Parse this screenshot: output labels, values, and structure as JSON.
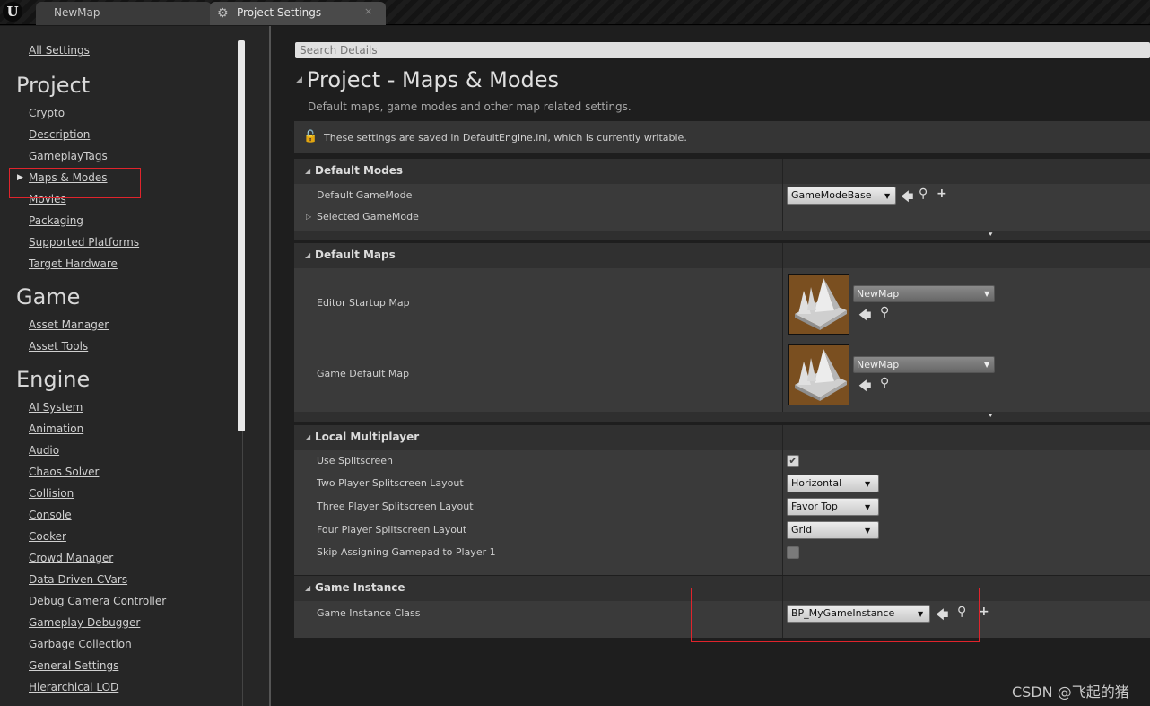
{
  "tabs": [
    {
      "label": "NewMap"
    },
    {
      "label": "Project Settings",
      "close": "×"
    }
  ],
  "logo_text": "U",
  "sidebar": {
    "all_settings": "All Settings",
    "groups": [
      {
        "heading": "Project",
        "items": [
          "Crypto",
          "Description",
          "GameplayTags",
          "Maps & Modes",
          "Movies",
          "Packaging",
          "Supported Platforms",
          "Target Hardware"
        ]
      },
      {
        "heading": "Game",
        "items": [
          "Asset Manager",
          "Asset Tools"
        ]
      },
      {
        "heading": "Engine",
        "items": [
          "AI System",
          "Animation",
          "Audio",
          "Chaos Solver",
          "Collision",
          "Console",
          "Cooker",
          "Crowd Manager",
          "Data Driven CVars",
          "Debug Camera Controller",
          "Gameplay Debugger",
          "Garbage Collection",
          "General Settings",
          "Hierarchical LOD"
        ]
      }
    ],
    "selected": "Maps & Modes"
  },
  "search": {
    "placeholder": "Search Details"
  },
  "page": {
    "title": "Project - Maps & Modes",
    "subtitle": "Default maps, game modes and other map related settings.",
    "notice": "These settings are saved in DefaultEngine.ini, which is currently writable."
  },
  "sections": {
    "default_modes": {
      "title": "Default Modes",
      "default_gamemode_label": "Default GameMode",
      "default_gamemode_value": "GameModeBase",
      "selected_gamemode_label": "Selected GameMode"
    },
    "default_maps": {
      "title": "Default Maps",
      "editor_startup_label": "Editor Startup Map",
      "editor_startup_value": "NewMap",
      "game_default_label": "Game Default Map",
      "game_default_value": "NewMap"
    },
    "local_multiplayer": {
      "title": "Local Multiplayer",
      "use_splitscreen_label": "Use Splitscreen",
      "use_splitscreen_checked": true,
      "two_player_label": "Two Player Splitscreen Layout",
      "two_player_value": "Horizontal",
      "three_player_label": "Three Player Splitscreen Layout",
      "three_player_value": "Favor Top",
      "four_player_label": "Four Player Splitscreen Layout",
      "four_player_value": "Grid",
      "skip_gamepad_label": "Skip Assigning Gamepad to Player 1",
      "skip_gamepad_checked": false
    },
    "game_instance": {
      "title": "Game Instance",
      "class_label": "Game Instance Class",
      "class_value": "BP_MyGameInstance"
    }
  },
  "watermark": "CSDN @飞起的猪",
  "colors": {
    "highlight_box": "#e0242c",
    "accent_orange": "#f09a1a",
    "panel_bg": "#262626"
  }
}
